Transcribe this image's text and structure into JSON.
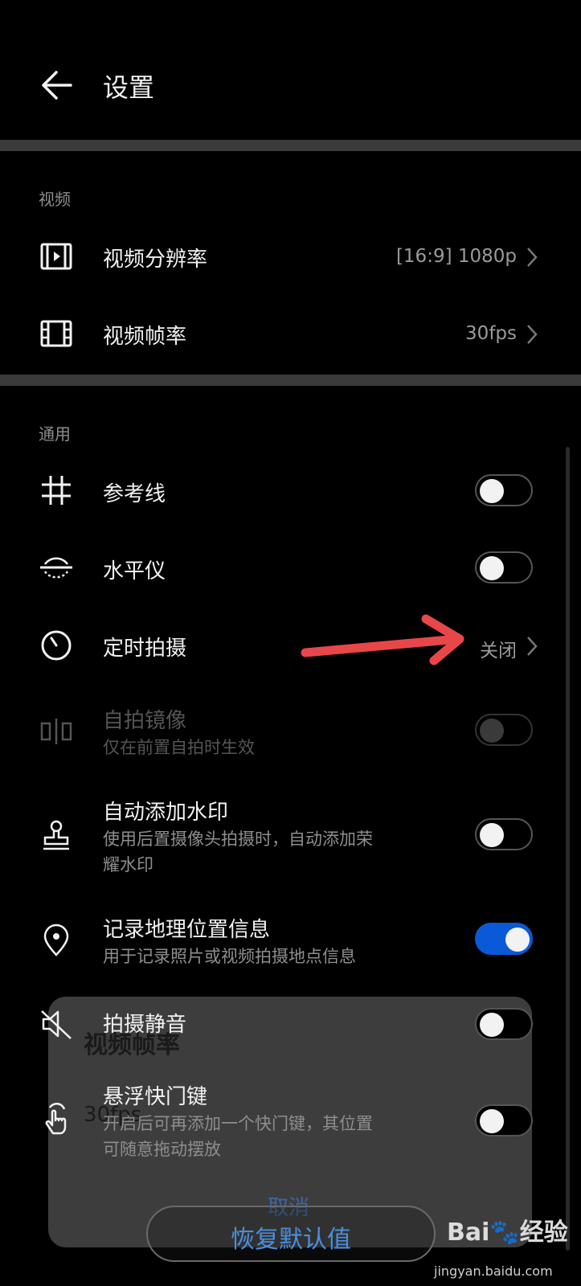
{
  "header": {
    "title": "设置"
  },
  "sections": {
    "video": "视频",
    "general": "通用"
  },
  "rows": {
    "resolution": {
      "label": "视频分辨率",
      "value": "[16:9] 1080p"
    },
    "framerate": {
      "label": "视频帧率",
      "value": "30fps"
    },
    "gridlines": {
      "label": "参考线",
      "on": false
    },
    "level": {
      "label": "水平仪",
      "on": false
    },
    "timer": {
      "label": "定时拍摄",
      "value": "关闭"
    },
    "mirror": {
      "label": "自拍镜像",
      "sub": "仅在前置自拍时生效",
      "on": false,
      "disabled": true
    },
    "watermark": {
      "label": "自动添加水印",
      "sub1": "使用后置摄像头拍摄时，自动添加荣",
      "sub2": "耀水印",
      "on": false
    },
    "location": {
      "label": "记录地理位置信息",
      "sub": "用于记录照片或视频拍摄地点信息",
      "on": true
    },
    "mute": {
      "label": "拍摄静音",
      "on": false
    },
    "floating": {
      "label": "悬浮快门键",
      "sub1": "开启后可再添加一个快门键，其位置",
      "sub2": "可随意拖动摆放",
      "on": false
    }
  },
  "dialog": {
    "title": "视频帧率",
    "value": "30fps",
    "cancel": "取消"
  },
  "restore_button": "恢复默认值",
  "watermark_brand": {
    "logo": "Bai🐾经验",
    "url": "jingyan.baidu.com"
  },
  "colors": {
    "accent": "#0a59d6",
    "annotation_arrow": "#e8474a"
  }
}
